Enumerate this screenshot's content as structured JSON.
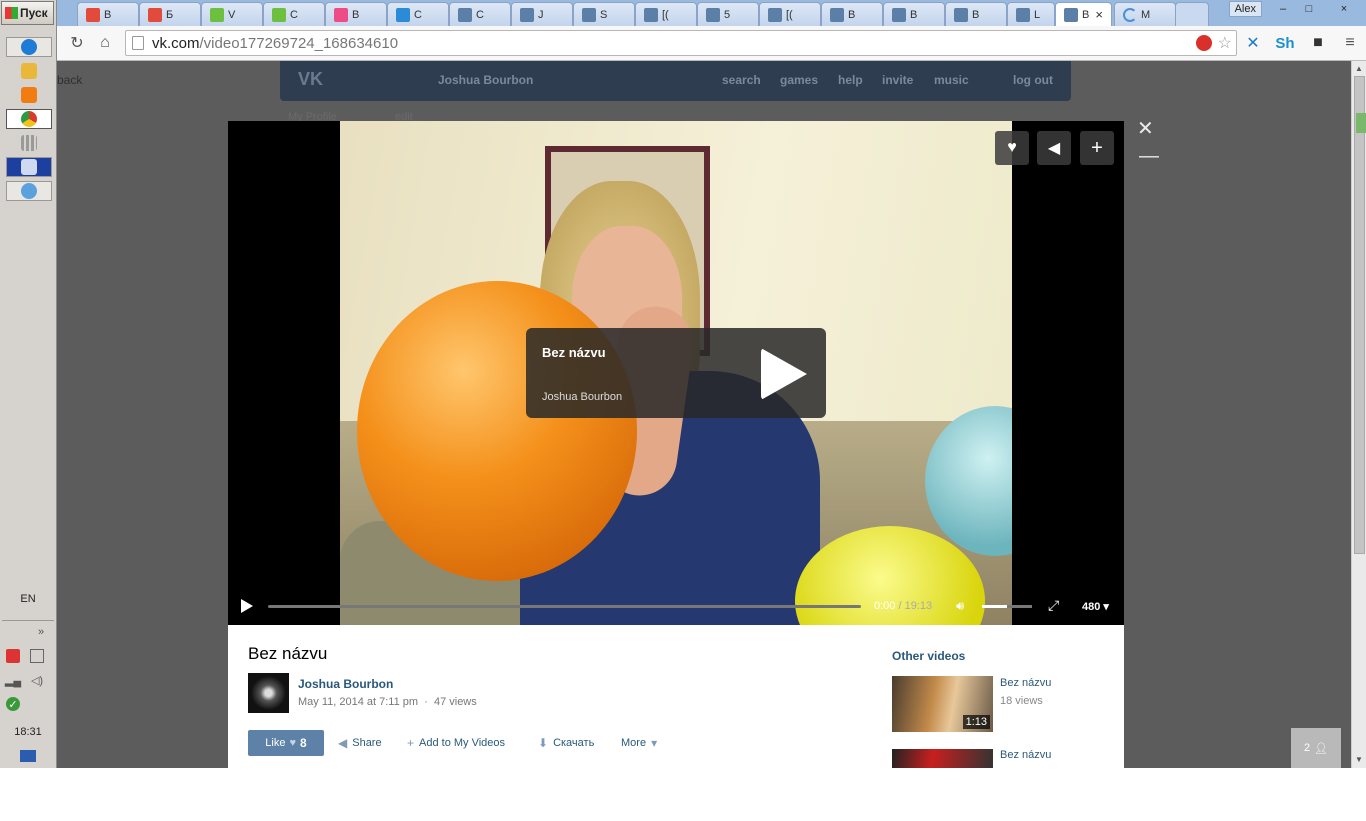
{
  "taskbar": {
    "start_label": "Пуск",
    "items": [
      {
        "icon": "ie-icon",
        "color": "#1e7bd6"
      },
      {
        "icon": "folder-icon",
        "color": "#e9b73a"
      },
      {
        "icon": "media-player-icon",
        "color": "#f07c12"
      },
      {
        "icon": "chrome-icon",
        "color": "#d83a2c"
      },
      {
        "icon": "apps-grid-icon",
        "color": "#9a9a9a"
      },
      {
        "icon": "reader-icon",
        "color": "#1d3fa0"
      },
      {
        "icon": "browser-icon",
        "color": "#5aa1de"
      }
    ],
    "lang": "EN",
    "show_more": "»",
    "clock": "18:31"
  },
  "browser": {
    "tabs": [
      {
        "label": "В",
        "color": "#e24b3b"
      },
      {
        "label": "Б",
        "color": "#e24b3b"
      },
      {
        "label": "V",
        "color": "#6cbf3f"
      },
      {
        "label": "С",
        "color": "#6cbf3f"
      },
      {
        "label": "В",
        "color": "#ee4b87"
      },
      {
        "label": "С",
        "color": "#2b8bd6"
      },
      {
        "label": "С",
        "color": "#5b7fa6"
      },
      {
        "label": "J",
        "color": "#5b7fa6"
      },
      {
        "label": "S",
        "color": "#5b7fa6"
      },
      {
        "label": "[(",
        "color": "#5b7fa6"
      },
      {
        "label": "5",
        "color": "#5b7fa6"
      },
      {
        "label": "[(",
        "color": "#5b7fa6"
      },
      {
        "label": "B",
        "color": "#5b7fa6"
      },
      {
        "label": "B",
        "color": "#5b7fa6"
      },
      {
        "label": "B",
        "color": "#5b7fa6"
      },
      {
        "label": "L",
        "color": "#5b7fa6"
      }
    ],
    "active_tab": {
      "label": "B",
      "close": "×"
    },
    "loading_tab": {
      "label": "M"
    },
    "profile": "Alex",
    "url_host": "vk.com",
    "url_path": "/video177269724_168634610",
    "window_controls": {
      "minimize": "–",
      "maximize": "□",
      "close": "×"
    }
  },
  "vk": {
    "header": {
      "logo": "VK",
      "back_name": "Joshua Bourbon",
      "nav": [
        "search",
        "games",
        "help",
        "invite",
        "music",
        "log out"
      ]
    },
    "bg_back": "back",
    "bg_profile": "My Profile",
    "bg_edit": "edit"
  },
  "video": {
    "title": "Bez názvu",
    "author": "Joshua Bourbon",
    "current_time": "0:00",
    "duration": "19:13",
    "time_sep": "/",
    "quality": "480",
    "volume": 0.5,
    "progress": 0.0
  },
  "info": {
    "title": "Bez názvu",
    "author": "Joshua Bourbon",
    "date": "May 11, 2014 at 7:11 pm",
    "views": "47 views",
    "like_label": "Like",
    "like_count": "8",
    "actions": {
      "share": "Share",
      "add": "Add to My Videos",
      "download": "Скачать",
      "more": "More"
    },
    "others_heading": "Other videos",
    "others": [
      {
        "title": "Bez názvu",
        "views": "18 views",
        "duration": "1:13"
      },
      {
        "title": "Bez názvu",
        "views": "",
        "duration": ""
      }
    ]
  },
  "chat": {
    "count": "2"
  }
}
